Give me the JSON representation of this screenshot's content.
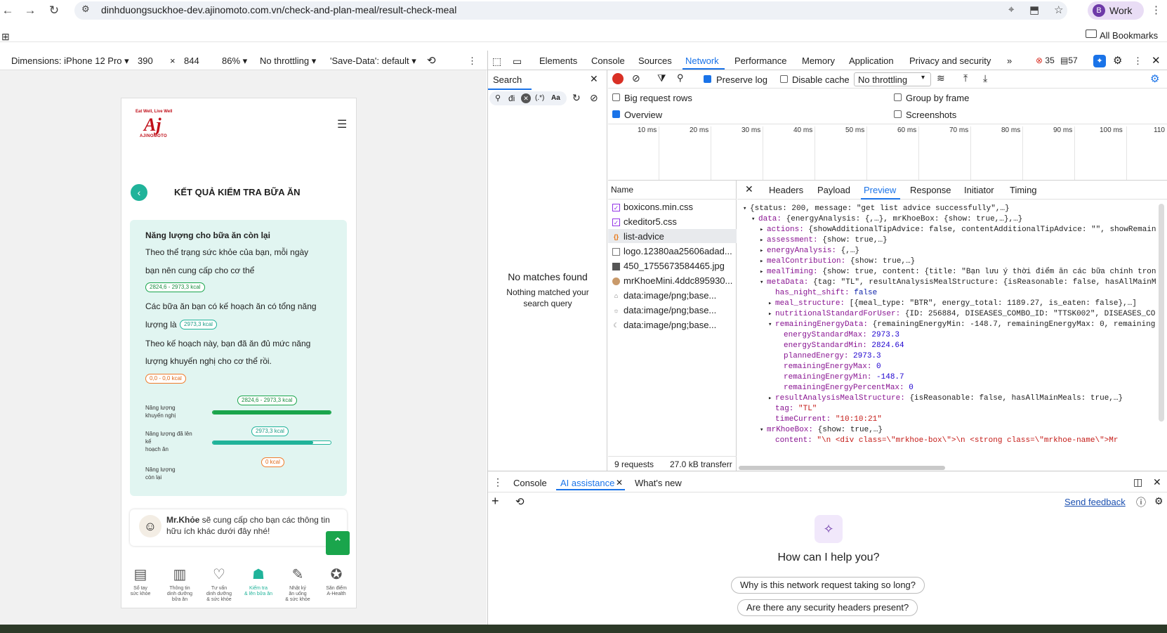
{
  "browser": {
    "url": "dinhduongsuckhoe-dev.ajinomoto.com.vn/check-and-plan-meal/result-check-meal",
    "profile_initial": "B",
    "profile_label": "Work",
    "all_bookmarks": "All Bookmarks"
  },
  "device_toolbar": {
    "dimensions": "Dimensions: iPhone 12 Pro",
    "width": "390",
    "times": "×",
    "height": "844",
    "zoom": "86%",
    "throttling": "No throttling",
    "save_data": "'Save-Data': default"
  },
  "page": {
    "logo_tagline": "Eat Well, Live Well",
    "logo_mark": "Aj",
    "logo_name": "AJINOMOTO",
    "title": "KẾT QUẢ KIỂM TRA BỮA ĂN",
    "panel_heading": "Năng lượng cho bữa ăn còn lại",
    "p1_line1": "Theo thể trạng sức khỏe của bạn, mỗi ngày",
    "p1_line2": "bạn nên cung cấp cho cơ thể",
    "badge_recommended": "2824,6 - 2973,3 kcal",
    "p2_line1": "Các bữa ăn bạn có kế hoạch ăn có tổng năng",
    "p2_line2": "lượng là",
    "badge_planned": "2973,3 kcal",
    "p3_line1": "Theo kế hoạch này, bạn đã ăn đủ mức năng",
    "p3_line2": "lượng khuyến nghị cho cơ thể rồi.",
    "badge_remaining": "0,0 - 0,0 kcal",
    "bars": [
      {
        "label_1": "Năng lượng",
        "label_2": "khuyến nghị",
        "label_3": "",
        "tag": "2824,6 - 2973,3 kcal",
        "fill": 1.0,
        "color": "#1aa54c"
      },
      {
        "label_1": "Năng lượng đã lên",
        "label_2": "kế",
        "label_3": "hoạch ăn",
        "tag": "2973,3 kcal",
        "fill": 0.85,
        "color": "#20b39a"
      },
      {
        "label_1": "Năng lượng",
        "label_2": "còn lại",
        "label_3": "",
        "tag": "0 kcal",
        "fill": 0,
        "color": "#f07b2b"
      }
    ],
    "mrkhoe_name": "Mr.Khỏe",
    "mrkhoe_text": " sẽ cung cấp cho bạn các thông tin hữu ích khác dưới đây nhé!",
    "bottom_nav": [
      {
        "icon": "notebook-icon",
        "line1": "Sổ tay",
        "line2": "sức khỏe",
        "line3": ""
      },
      {
        "icon": "book-icon",
        "line1": "Thông tin",
        "line2": "dinh dưỡng",
        "line3": "bữa ăn"
      },
      {
        "icon": "heart-icon",
        "line1": "Tư vấn",
        "line2": "dinh dưỡng",
        "line3": "& sức khỏe"
      },
      {
        "icon": "chef-hat-icon",
        "line1": "Kiểm tra",
        "line2": "& lên bữa ăn",
        "line3": ""
      },
      {
        "icon": "journal-icon",
        "line1": "Nhật ký",
        "line2": "ăn uống",
        "line3": "& sức khỏe"
      },
      {
        "icon": "medal-icon",
        "line1": "Săn điểm",
        "line2": "A-Health",
        "line3": ""
      }
    ],
    "active_nav": 3
  },
  "devtools": {
    "tabs": [
      "Elements",
      "Console",
      "Sources",
      "Network",
      "Performance",
      "Memory",
      "Application",
      "Privacy and security"
    ],
    "active_tab": "Network",
    "errors": "35",
    "messages": "57",
    "search_title": "Search",
    "search_value": "đi",
    "search_regex": "(.*)",
    "search_case": "Aa",
    "no_matches": "No matches found",
    "no_matches_sub1": "Nothing matched your",
    "no_matches_sub2": "search query",
    "preserve_log": "Preserve log",
    "disable_cache": "Disable cache",
    "throttling": "No throttling",
    "big_request_rows": "Big request rows",
    "group_by_frame": "Group by frame",
    "overview": "Overview",
    "screenshots": "Screenshots",
    "timeline_ticks": [
      "10 ms",
      "20 ms",
      "30 ms",
      "40 ms",
      "50 ms",
      "60 ms",
      "70 ms",
      "80 ms",
      "90 ms",
      "100 ms",
      "110"
    ],
    "name_header": "Name",
    "requests": [
      {
        "name": "boxicons.min.css",
        "icon": "css-icon"
      },
      {
        "name": "ckeditor5.css",
        "icon": "css-icon"
      },
      {
        "name": "list-advice",
        "icon": "fetch-icon"
      },
      {
        "name": "logo.12380aa25606adad...",
        "icon": "image-icon"
      },
      {
        "name": "450_1755673584465.jpg",
        "icon": "image-icon"
      },
      {
        "name": "mrKhoeMini.4ddc895930...",
        "icon": "image-icon"
      },
      {
        "name": "data:image/png;base...",
        "icon": "image-icon"
      },
      {
        "name": "data:image/png;base...",
        "icon": "image-icon"
      },
      {
        "name": "data:image/png;base...",
        "icon": "image-icon"
      }
    ],
    "selected_request": 2,
    "status_requests": "9 requests",
    "status_transfer": "27.0 kB transferr",
    "detail_tabs": [
      "Headers",
      "Payload",
      "Preview",
      "Response",
      "Initiator",
      "Timing"
    ],
    "active_detail_tab": "Preview",
    "preview_lines": [
      {
        "arrow": "▾",
        "key": "",
        "text": "{status: 200, message: \"get list advice successfully\",…}",
        "cls": "",
        "indent": 0
      },
      {
        "arrow": "▾",
        "key": "data:",
        "text": " {energyAnalysis: {,…}, mrKhoeBox: {show: true,…},…}",
        "cls": "",
        "indent": 1
      },
      {
        "arrow": "▸",
        "key": "actions:",
        "text": " {showAdditionalTipAdvice: false, contentAdditionalTipAdvice: \"\", showRemain",
        "cls": "",
        "indent": 2
      },
      {
        "arrow": "▸",
        "key": "assessment:",
        "text": " {show: true,…}",
        "cls": "",
        "indent": 2
      },
      {
        "arrow": "▸",
        "key": "energyAnalysis:",
        "text": " {,…}",
        "cls": "",
        "indent": 2
      },
      {
        "arrow": "▸",
        "key": "mealContribution:",
        "text": " {show: true,…}",
        "cls": "",
        "indent": 2
      },
      {
        "arrow": "▸",
        "key": "mealTiming:",
        "text": " {show: true, content: {title: \"Bạn lưu ý thời điểm ăn các bữa chính tron",
        "cls": "",
        "indent": 2
      },
      {
        "arrow": "▾",
        "key": "metaData:",
        "text": " {tag: \"TL\", resultAnalysisMealStructure: {isReasonable: false, hasAllMainM",
        "cls": "",
        "indent": 2
      },
      {
        "arrow": "",
        "key": "has_night_shift:",
        "text": " false",
        "cls": "kw",
        "indent": 3
      },
      {
        "arrow": "▸",
        "key": "meal_structure:",
        "text": " [{meal_type: \"BTR\", energy_total: 1189.27, is_eaten: false},…]",
        "cls": "",
        "indent": 3
      },
      {
        "arrow": "▸",
        "key": "nutritionalStandardForUser:",
        "text": " {ID: 256884, DISEASES_COMBO_ID: \"TTSK002\", DISEASES_CO",
        "cls": "",
        "indent": 3
      },
      {
        "arrow": "▾",
        "key": "remainingEnergyData:",
        "text": " {remainingEnergyMin: -148.7, remainingEnergyMax: 0, remaining",
        "cls": "",
        "indent": 3
      },
      {
        "arrow": "",
        "key": "energyStandardMax:",
        "text": " 2973.3",
        "cls": "num",
        "indent": 4
      },
      {
        "arrow": "",
        "key": "energyStandardMin:",
        "text": " 2824.64",
        "cls": "num",
        "indent": 4
      },
      {
        "arrow": "",
        "key": "plannedEnergy:",
        "text": " 2973.3",
        "cls": "num",
        "indent": 4
      },
      {
        "arrow": "",
        "key": "remainingEnergyMax:",
        "text": " 0",
        "cls": "num",
        "indent": 4
      },
      {
        "arrow": "",
        "key": "remainingEnergyMin:",
        "text": " -148.7",
        "cls": "num",
        "indent": 4
      },
      {
        "arrow": "",
        "key": "remainingEnergyPercentMax:",
        "text": " 0",
        "cls": "num",
        "indent": 4
      },
      {
        "arrow": "▸",
        "key": "resultAnalysisMealStructure:",
        "text": " {isReasonable: false, hasAllMainMeals: true,…}",
        "cls": "",
        "indent": 3
      },
      {
        "arrow": "",
        "key": "tag:",
        "text": " \"TL\"",
        "cls": "str",
        "indent": 3
      },
      {
        "arrow": "",
        "key": "timeCurrent:",
        "text": " \"10:10:21\"",
        "cls": "str",
        "indent": 3
      },
      {
        "arrow": "▾",
        "key": "mrKhoeBox:",
        "text": " {show: true,…}",
        "cls": "",
        "indent": 2
      },
      {
        "arrow": "",
        "key": "content:",
        "text": " \"\\n    <div class=\\\"mrkhoe-box\\\">\\n      <strong class=\\\"mrkhoe-name\\\">Mr",
        "cls": "str",
        "indent": 3
      }
    ],
    "drawer_tabs": [
      "Console",
      "AI assistance",
      "What's new"
    ],
    "active_drawer_tab": "AI assistance",
    "send_feedback": "Send feedback",
    "ai_heading": "How can I help you?",
    "suggestions": [
      "Why is this network request taking so long?",
      "Are there any security headers present?"
    ]
  },
  "colors": {
    "accent_teal": "#20b39a",
    "green": "#1aa54c",
    "orange": "#f07b2b",
    "devtools_blue": "#1a73e8"
  }
}
